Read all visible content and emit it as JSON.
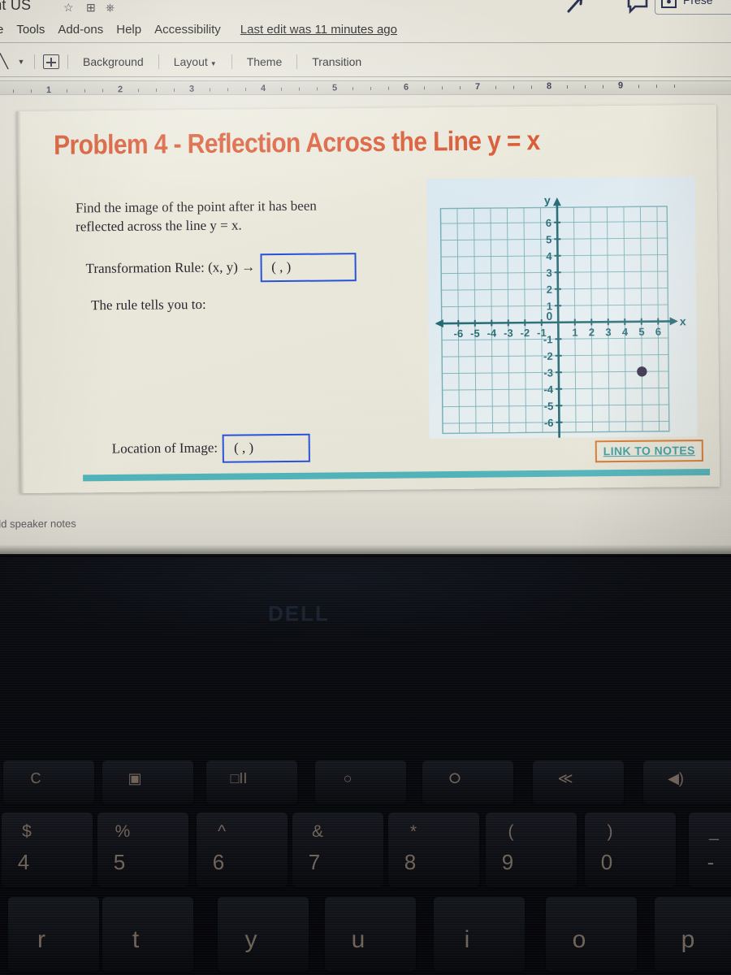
{
  "app": {
    "doc_title": "ent US",
    "star_icon": "star-icon",
    "move_icon": "move-to-folder-icon",
    "cloud_icon": "cloud-saved-icon",
    "share_icon": "share-icon",
    "comment_icon": "comment-icon",
    "present_icon": "present-icon",
    "present_label": "Prese"
  },
  "menubar": {
    "items": [
      {
        "label": "e"
      },
      {
        "label": "Tools"
      },
      {
        "label": "Add-ons"
      },
      {
        "label": "Help"
      },
      {
        "label": "Accessibility"
      }
    ],
    "last_edit": "Last edit was 11 minutes ago"
  },
  "toolbar": {
    "line_tool_icon": "line-tool-icon",
    "line_caret_icon": "chevron-down-icon",
    "textbox_icon": "new-slide-icon",
    "background_label": "Background",
    "layout_label": "Layout",
    "layout_caret": "▾",
    "theme_label": "Theme",
    "transition_label": "Transition"
  },
  "ruler": {
    "marks": [
      "1",
      "2",
      "3",
      "4",
      "5",
      "6",
      "7",
      "8",
      "9"
    ]
  },
  "slide": {
    "title": "Problem 4 - Reflection Across the Line y = x",
    "title_color": "#d7522b",
    "accent_bar_color": "#4fb2b9",
    "prompt": "Find the image of the point after it has been reflected across the line y = x.",
    "rule_label": "Transformation Rule: (x, y) →",
    "rule_answer": "( ,  )",
    "tells_label": "The rule tells you to:",
    "location_label": "Location of Image:",
    "location_answer": "( ,  )",
    "link_to_notes": "LINK TO NOTES",
    "link_border_color": "#d4762d",
    "link_text_color": "#3c9aa0",
    "answer_box_border_color": "#2752d8"
  },
  "chart_data": {
    "type": "scatter",
    "title": "",
    "xlabel": "x",
    "ylabel": "y",
    "xlim": [
      -7,
      7
    ],
    "ylim": [
      -7,
      7
    ],
    "xticks": [
      -6,
      -5,
      -4,
      -3,
      -2,
      -1,
      0,
      1,
      2,
      3,
      4,
      5,
      6
    ],
    "yticks": [
      -6,
      -5,
      -4,
      -3,
      -2,
      -1,
      1,
      2,
      3,
      4,
      5,
      6
    ],
    "origin_label": "0",
    "grid": true,
    "grid_color": "#6aa9ae",
    "axis_color": "#17606b",
    "background": "#dde9ef",
    "points": [
      {
        "x": 5,
        "y": -3,
        "color": "#2b2440",
        "label": ""
      }
    ],
    "legend": null
  },
  "notes": {
    "placeholder": "dd speaker notes"
  },
  "laptop": {
    "brand": "DELL",
    "function_keys": [
      {
        "glyph": "C",
        "name": "refresh-key"
      },
      {
        "glyph": "▣",
        "name": "full-screen-key"
      },
      {
        "glyph": "□II",
        "name": "window-switch-key"
      },
      {
        "glyph": "○",
        "name": "brightness-down-key"
      },
      {
        "glyph": "⭘",
        "name": "brightness-up-key"
      },
      {
        "glyph": "≪",
        "name": "mute-key"
      },
      {
        "glyph": "◀)",
        "name": "volume-down-key"
      }
    ],
    "number_row": [
      {
        "shift": "$",
        "num": "4"
      },
      {
        "shift": "%",
        "num": "5"
      },
      {
        "shift": "^",
        "num": "6"
      },
      {
        "shift": "&",
        "num": "7"
      },
      {
        "shift": "*",
        "num": "8"
      },
      {
        "shift": "(",
        "num": "9"
      },
      {
        "shift": ")",
        "num": "0"
      },
      {
        "shift": "_",
        "num": "-"
      }
    ],
    "letter_row": [
      "r",
      "t",
      "y",
      "u",
      "i",
      "o",
      "p"
    ]
  }
}
